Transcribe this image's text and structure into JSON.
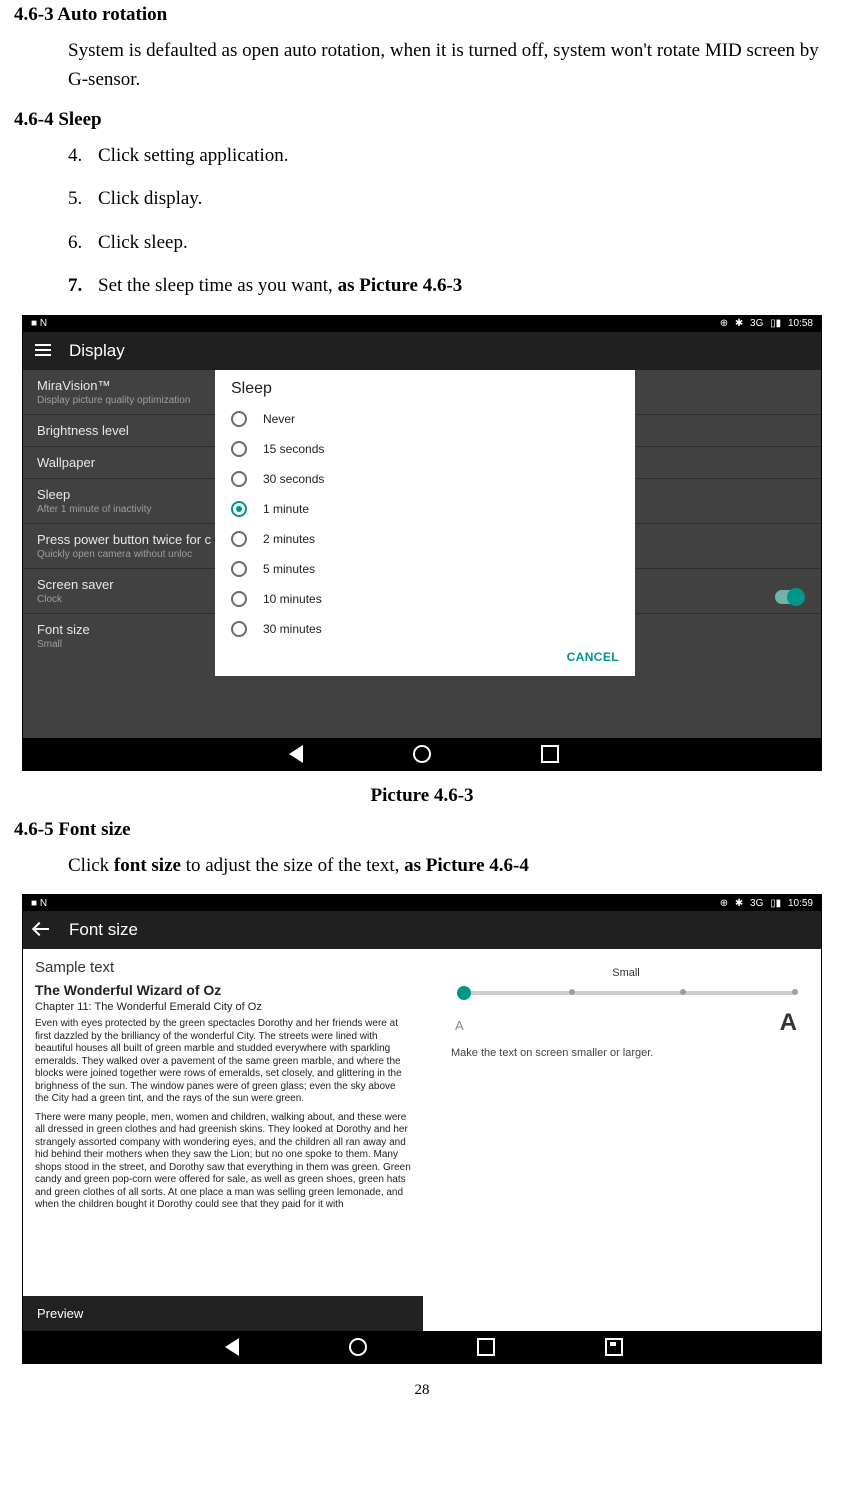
{
  "sections": {
    "auto_rotation": {
      "heading": "4.6-3 Auto rotation",
      "para": "System is defaulted as open auto rotation, when it is turned off, system won't rotate MID screen by G-sensor."
    },
    "sleep": {
      "heading": "4.6-4 Sleep",
      "steps": [
        {
          "num": "4.",
          "text": "Click setting application."
        },
        {
          "num": "5.",
          "text": "Click display."
        },
        {
          "num": "6.",
          "text": "Click sleep."
        }
      ],
      "step7_num": "7.",
      "step7_a": "Set the sleep time as you want, ",
      "step7_b": "as Picture 4.6-3"
    },
    "caption_1": "Picture 4.6-3",
    "font_size": {
      "heading": "4.6-5 Font size",
      "para_a": "Click ",
      "para_b": "font size",
      "para_c": " to adjust the size of the text, ",
      "para_d": "as Picture 4.6-4"
    }
  },
  "shot1": {
    "status_time": "10:58",
    "status_left": "■  N",
    "status_right_1": "⊕",
    "status_right_2": "✱",
    "status_right_3": "3G",
    "status_right_4": "▯▮",
    "screen_title": "Display",
    "rows": [
      {
        "title": "MiraVision™",
        "sub": "Display picture quality optimization"
      },
      {
        "title": "Brightness level",
        "sub": ""
      },
      {
        "title": "Wallpaper",
        "sub": ""
      },
      {
        "title": "Sleep",
        "sub": "After 1 minute of inactivity"
      },
      {
        "title": "Press power button twice for c",
        "sub": "Quickly open camera without unloc"
      },
      {
        "title": "Screen saver",
        "sub": "Clock"
      },
      {
        "title": "Font size",
        "sub": "Small"
      }
    ],
    "dialog_title": "Sleep",
    "options": [
      "Never",
      "15 seconds",
      "30 seconds",
      "1 minute",
      "2 minutes",
      "5 minutes",
      "10 minutes",
      "30 minutes"
    ],
    "selected_index": 3,
    "cancel": "CANCEL"
  },
  "shot2": {
    "status_time": "10:59",
    "status_left": "■  N",
    "status_right_1": "⊕",
    "status_right_2": "✱",
    "status_right_3": "3G",
    "status_right_4": "▯▮",
    "screen_title": "Font size",
    "sample_label": "Sample text",
    "book_title": "The Wonderful Wizard of Oz",
    "chapter": "Chapter 11: The Wonderful Emerald City of Oz",
    "para1": "Even with eyes protected by the green spectacles Dorothy and her friends were at first dazzled by the brilliancy of the wonderful City. The streets were lined with beautiful houses all built of green marble and studded everywhere with sparkling emeralds. They walked over a pavement of the same green marble, and where the blocks were joined together were rows of emeralds, set closely, and glittering in the brighness of the sun. The window panes were of green glass; even the sky above the City had a green tint, and the rays of the sun were green.",
    "para2": "There were many people, men, women and children, walking about, and these were all dressed in green clothes and had greenish skins. They looked at Dorothy and her strangely assorted company with wondering eyes, and the children all ran away and hid behind their mothers when they saw the Lion; but no one spoke to them. Many shops stood in the street, and Dorothy saw that everything in them was green. Green candy and green pop-corn were offered for sale, as well as green shoes, green hats and green clothes of all sorts. At one place a man was selling green lemonade, and when the children bought it Dorothy could see that they paid for it with",
    "preview_label": "Preview",
    "slider_label": "Small",
    "small_A": "A",
    "big_A": "A",
    "helper": "Make the text on screen smaller or larger."
  },
  "page_number": "28"
}
